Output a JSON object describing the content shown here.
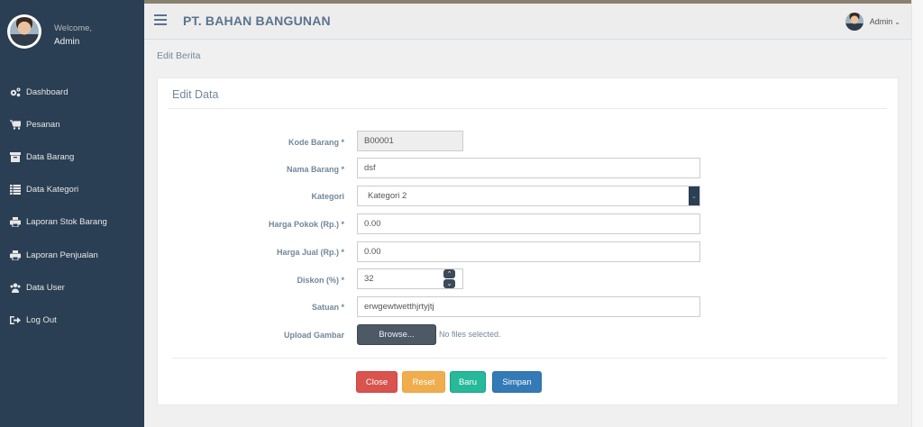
{
  "sidebar": {
    "welcome": "Welcome,",
    "username": "Admin",
    "items": [
      {
        "label": "Dashboard",
        "icon": "cogs-icon"
      },
      {
        "label": "Pesanan",
        "icon": "cart-icon"
      },
      {
        "label": "Data Barang",
        "icon": "box-icon"
      },
      {
        "label": "Data Kategori",
        "icon": "list-icon"
      },
      {
        "label": "Laporan Stok Barang",
        "icon": "print-icon"
      },
      {
        "label": "Laporan Penjualan",
        "icon": "print-icon"
      },
      {
        "label": "Data User",
        "icon": "users-icon"
      },
      {
        "label": "Log Out",
        "icon": "sign-out-icon"
      }
    ]
  },
  "topnav": {
    "brand": "PT. BAHAN BANGUNAN",
    "user": "Admin",
    "caret": "⌄"
  },
  "breadcrumb": "Edit Berita",
  "panel": {
    "title": "Edit Data"
  },
  "form": {
    "kode_barang": {
      "label": "Kode Barang *",
      "value": "B00001"
    },
    "nama_barang": {
      "label": "Nama Barang *",
      "value": "dsf"
    },
    "kategori": {
      "label": "Kategori",
      "value": "Kategori 2"
    },
    "harga_pokok": {
      "label": "Harga Pokok (Rp.) *",
      "value": "0.00"
    },
    "harga_jual": {
      "label": "Harga Jual (Rp.) *",
      "value": "0.00"
    },
    "diskon": {
      "label": "Diskon (%) *",
      "value": "32"
    },
    "satuan": {
      "label": "Satuan *",
      "value": "erwgewtwetthjrtyjtj"
    },
    "upload": {
      "label": "Upload Gambar",
      "button": "Browse...",
      "status": "No files selected."
    }
  },
  "buttons": {
    "close": "Close",
    "reset": "Reset",
    "baru": "Baru",
    "simpan": "Simpan"
  },
  "colors": {
    "sidebar": "#2a3f54",
    "danger": "#d9534f",
    "warning": "#f0ad4e",
    "success": "#26b99a",
    "primary": "#337ab7"
  }
}
